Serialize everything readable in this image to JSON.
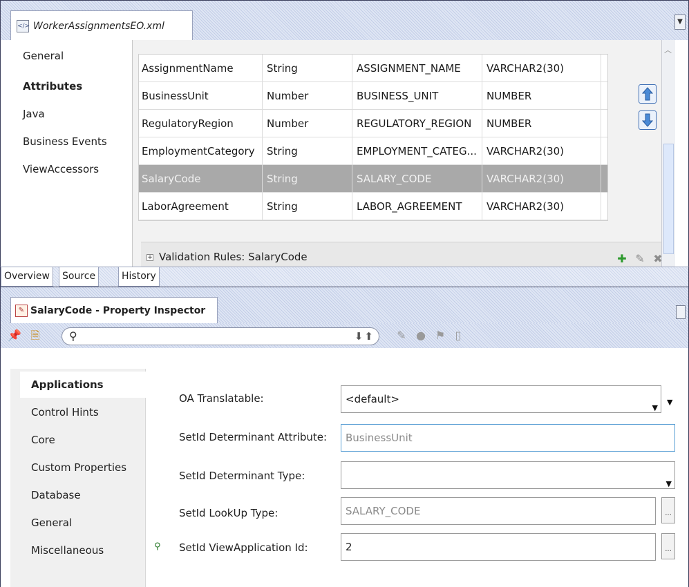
{
  "editor": {
    "file_tab": "WorkerAssignmentsEO.xml",
    "nav": [
      "General",
      "Attributes",
      "Java",
      "Business Events",
      "ViewAccessors"
    ],
    "selected_nav": "Attributes",
    "attributes": [
      {
        "name": "AssignmentName",
        "type": "String",
        "column": "ASSIGNMENT_NAME",
        "db_type": "VARCHAR2(30)"
      },
      {
        "name": "BusinessUnit",
        "type": "Number",
        "column": "BUSINESS_UNIT",
        "db_type": "NUMBER"
      },
      {
        "name": "RegulatoryRegion",
        "type": "Number",
        "column": "REGULATORY_REGION",
        "db_type": "NUMBER"
      },
      {
        "name": "EmploymentCategory",
        "type": "String",
        "column": "EMPLOYMENT_CATEG...",
        "db_type": "VARCHAR2(30)"
      },
      {
        "name": "SalaryCode",
        "type": "String",
        "column": "SALARY_CODE",
        "db_type": "VARCHAR2(30)"
      },
      {
        "name": "LaborAgreement",
        "type": "String",
        "column": "LABOR_AGREEMENT",
        "db_type": "VARCHAR2(30)"
      }
    ],
    "selected_attribute": "SalaryCode",
    "validation_rules": "Validation Rules: SalaryCode"
  },
  "bottom_tabs": [
    "Overview",
    "Source",
    "History"
  ],
  "inspector": {
    "title": "SalaryCode - Property Inspector",
    "search_value": "",
    "nav": [
      "Applications",
      "Control Hints",
      "Core",
      "Custom Properties",
      "Database",
      "General",
      "Miscellaneous"
    ],
    "selected_nav": "Applications",
    "properties": {
      "oa_translatable": {
        "label": "OA Translatable:",
        "value": "<default>"
      },
      "setid_determinant_attribute": {
        "label": "SetId Determinant Attribute:",
        "value": "BusinessUnit"
      },
      "setid_determinant_type": {
        "label": "SetId Determinant Type:",
        "value": ""
      },
      "setid_lookup_type": {
        "label": "SetId LookUp Type:",
        "value": "SALARY_CODE"
      },
      "setid_view_application_id": {
        "label": "SetId ViewApplication Id:",
        "value": "2"
      }
    }
  },
  "colors": {
    "selected_row": "#a9a9a9",
    "frame_border": "#3b3f5c",
    "arrow_blue": "#3e6fb5",
    "add_green": "#2e9a2e",
    "delete_gray": "#8c8c8c"
  }
}
